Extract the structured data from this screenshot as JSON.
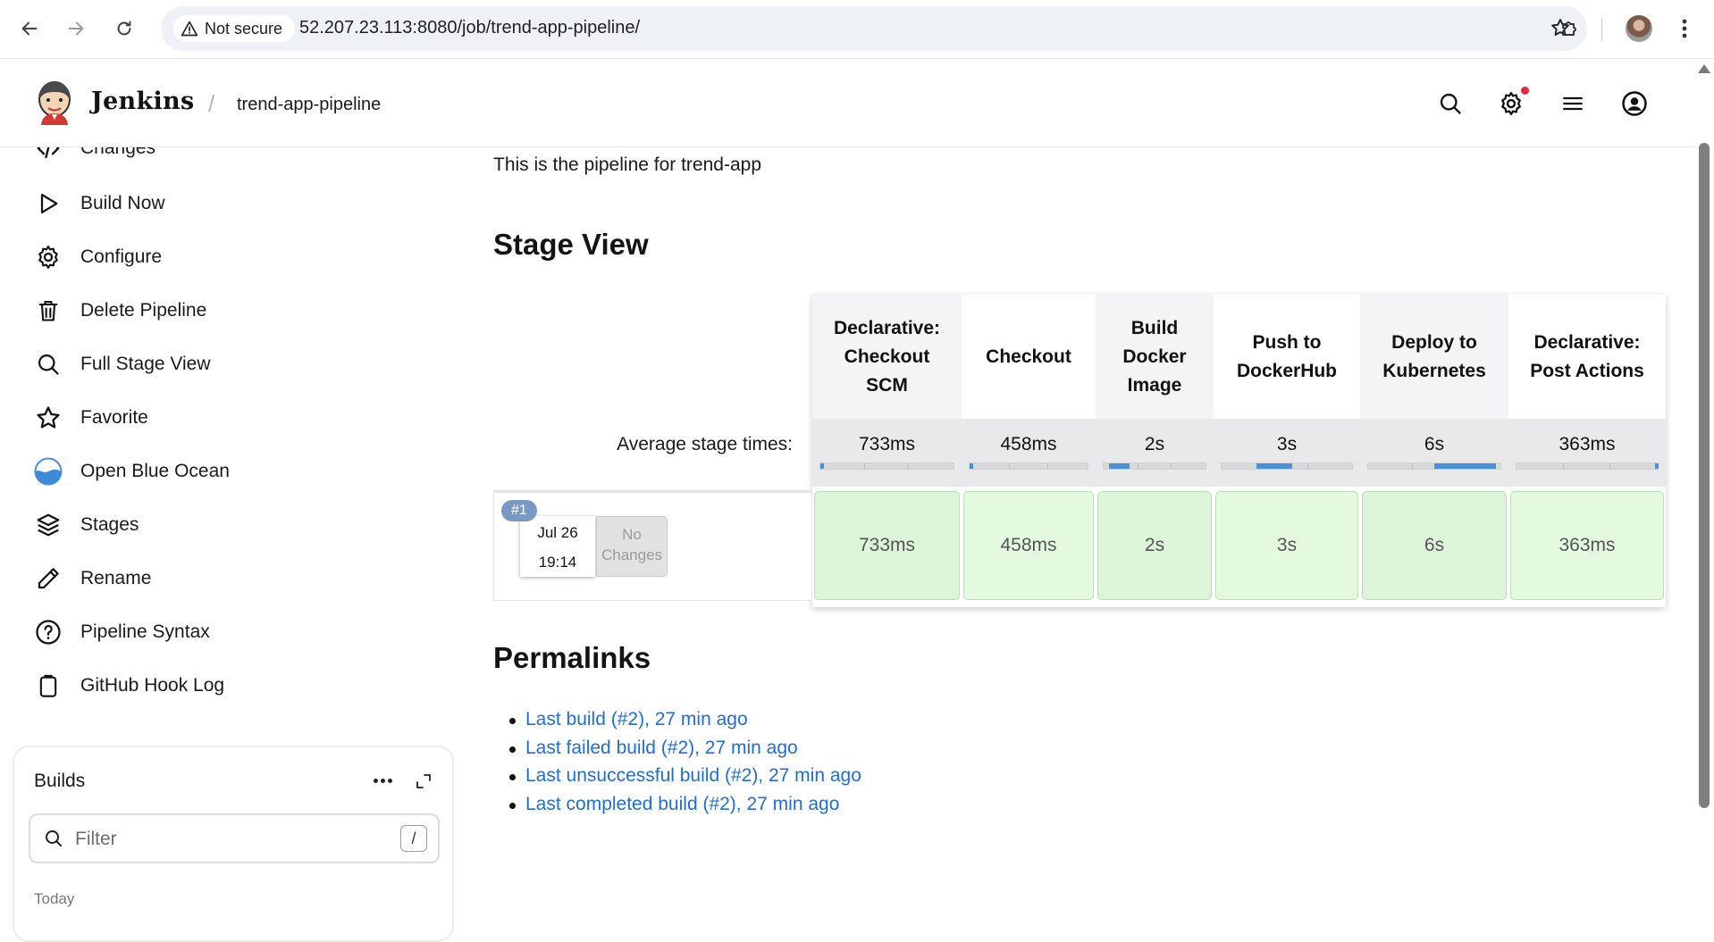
{
  "browser": {
    "security_label": "Not secure",
    "url": "52.207.23.113:8080/job/trend-app-pipeline/"
  },
  "header": {
    "app_name": "Jenkins",
    "breadcrumb": "trend-app-pipeline",
    "icons": [
      "search-icon",
      "manage-gear-icon",
      "menu-icon",
      "user-icon"
    ],
    "notification_color": "#e6283c"
  },
  "sidebar": {
    "items": [
      {
        "label": "Changes",
        "icon": "code-icon"
      },
      {
        "label": "Build Now",
        "icon": "play-icon"
      },
      {
        "label": "Configure",
        "icon": "gear-icon"
      },
      {
        "label": "Delete Pipeline",
        "icon": "trash-icon"
      },
      {
        "label": "Full Stage View",
        "icon": "search-icon"
      },
      {
        "label": "Favorite",
        "icon": "star-icon"
      },
      {
        "label": "Open Blue Ocean",
        "icon": "blue-ocean-icon"
      },
      {
        "label": "Stages",
        "icon": "layers-icon"
      },
      {
        "label": "Rename",
        "icon": "pencil-icon"
      },
      {
        "label": "Pipeline Syntax",
        "icon": "help-icon"
      },
      {
        "label": "GitHub Hook Log",
        "icon": "clipboard-icon"
      }
    ]
  },
  "builds": {
    "title": "Builds",
    "filter_placeholder": "Filter",
    "shortcut_key": "/",
    "group_label": "Today"
  },
  "main": {
    "description": "This is the pipeline for trend-app",
    "stage_view_heading": "Stage View",
    "avg_label": "Average stage times:",
    "stages": [
      {
        "name": "Declarative: Checkout SCM",
        "avg": "733ms",
        "run": "733ms",
        "avg_fraction": 0.0
      },
      {
        "name": "Checkout",
        "avg": "458ms",
        "run": "458ms",
        "avg_fraction": 0.0
      },
      {
        "name": "Build Docker Image",
        "avg": "2s",
        "run": "2s",
        "avg_fraction": 0.2
      },
      {
        "name": "Push to DockerHub",
        "avg": "3s",
        "run": "3s",
        "avg_fraction": 0.27
      },
      {
        "name": "Deploy to Kubernetes",
        "avg": "6s",
        "run": "6s",
        "avg_fraction": 0.46
      },
      {
        "name": "Declarative: Post Actions",
        "avg": "363ms",
        "run": "363ms",
        "avg_fraction": 0.0
      }
    ],
    "build": {
      "number": "#1",
      "date": "Jul 26",
      "time": "19:14",
      "changes": "No Changes"
    },
    "permalinks_heading": "Permalinks",
    "permalinks": [
      "Last build (#2), 27 min ago",
      "Last failed build (#2), 27 min ago",
      "Last unsuccessful build (#2), 27 min ago",
      "Last completed build (#2), 27 min ago"
    ],
    "colors": {
      "link": "#1f6ed4",
      "success_cell": "#dcf4d8",
      "progress_fill": "#4a90d9"
    }
  }
}
